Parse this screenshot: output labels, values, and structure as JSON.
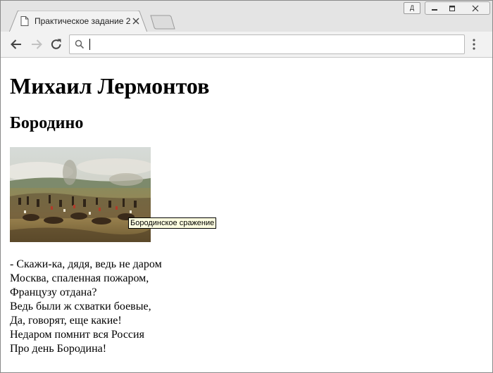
{
  "browser": {
    "user_badge": "Д",
    "tab": {
      "title": "Практическое задание 2"
    },
    "address": {
      "value": "",
      "placeholder": ""
    }
  },
  "page": {
    "heading": "Михаил Лермонтов",
    "subheading": "Бородино",
    "image_title": "Бородинское сражение",
    "poem_lines": [
      "- Скажи-ка, дядя, ведь не даром",
      "Москва, спаленная пожаром,",
      "Французу отдана?",
      "Ведь были ж схватки боевые,",
      "Да, говорят, еще какие!",
      "Недаром помнит вся Россия",
      "Про день Бородина!"
    ]
  }
}
